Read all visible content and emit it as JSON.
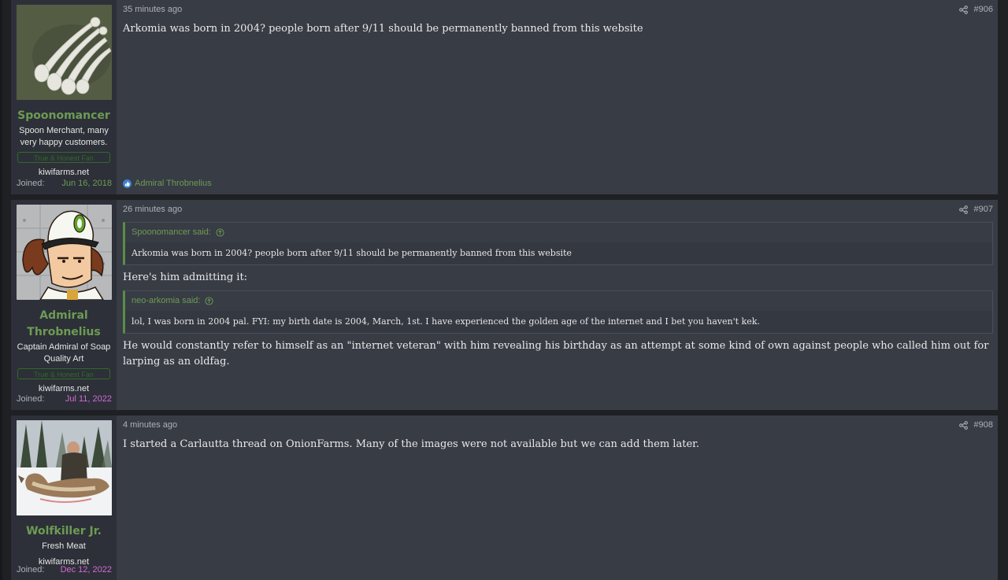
{
  "posts": [
    {
      "user": {
        "name": "Spoonomancer",
        "title": "Spoon Merchant, many very happy customers.",
        "banner": "True & Honest Fan",
        "site": "kiwifarms.net",
        "joined_label": "Joined:",
        "joined_date": "Jun 16, 2018",
        "joined_color": "#6d9b54"
      },
      "time": "35 minutes ago",
      "number": "#906",
      "body": "Arkomia was born in 2004? people born after 9/11 should be permanently banned from this website",
      "reaction_user": "Admiral Throbnelius"
    },
    {
      "user": {
        "name": "Admiral Throbnelius",
        "title": "Captain Admiral of Soap Quality Art",
        "banner": "True & Honest Fan",
        "site": "kiwifarms.net",
        "joined_label": "Joined:",
        "joined_date": "Jul 11, 2022",
        "joined_color": "#d36ad6"
      },
      "time": "26 minutes ago",
      "number": "#907",
      "quote1": {
        "author": "Spoonomancer said:",
        "text": "Arkomia was born in 2004? people born after 9/11 should be permanently banned from this website"
      },
      "text1": "Here's him admitting it:",
      "quote2": {
        "author": "neo-arkomia said:",
        "text": "lol, I was born in 2004 pal. FYI: my birth date is 2004, March, 1st. I have experienced the golden age of the internet and I bet you haven't kek."
      },
      "text2": "He would constantly refer to himself as an \"internet veteran\" with him revealing his birthday as an attempt at some kind of own against people who called him out for larping as an oldfag."
    },
    {
      "user": {
        "name": "Wolfkiller Jr.",
        "title": "Fresh Meat",
        "site": "kiwifarms.net",
        "joined_label": "Joined:",
        "joined_date": "Dec 12, 2022",
        "joined_color": "#d36ad6"
      },
      "time": "4 minutes ago",
      "number": "#908",
      "body": "I started a Carlautta thread on OnionFarms. Many of the images were not available but we can add them later."
    }
  ]
}
